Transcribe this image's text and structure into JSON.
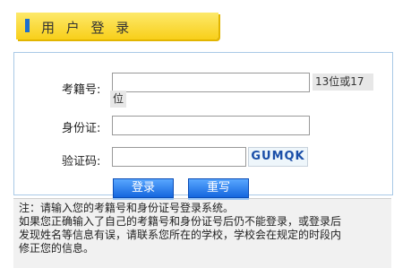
{
  "header": {
    "title": "用 户 登 录"
  },
  "form": {
    "exam_id_label": "考籍号:",
    "exam_id_value": "",
    "exam_id_hint_line1": "13位或17",
    "exam_id_hint_line2": "位",
    "id_card_label": "身份证:",
    "id_card_value": "",
    "captcha_label": "验证码:",
    "captcha_value": "",
    "captcha_text": "GUMQK"
  },
  "buttons": {
    "login": "登录",
    "reset": "重写"
  },
  "notice": {
    "line1": "注：请输入您的考籍号和身份证号登录系统。",
    "line2": "如果您正确输入了自己的考籍号和身份证号后仍不能登录，或登录后",
    "line3": "发现姓名等信息有误，请联系您所在的学校，学校会在规定的时段内",
    "line4": "修正您的信息。"
  }
}
